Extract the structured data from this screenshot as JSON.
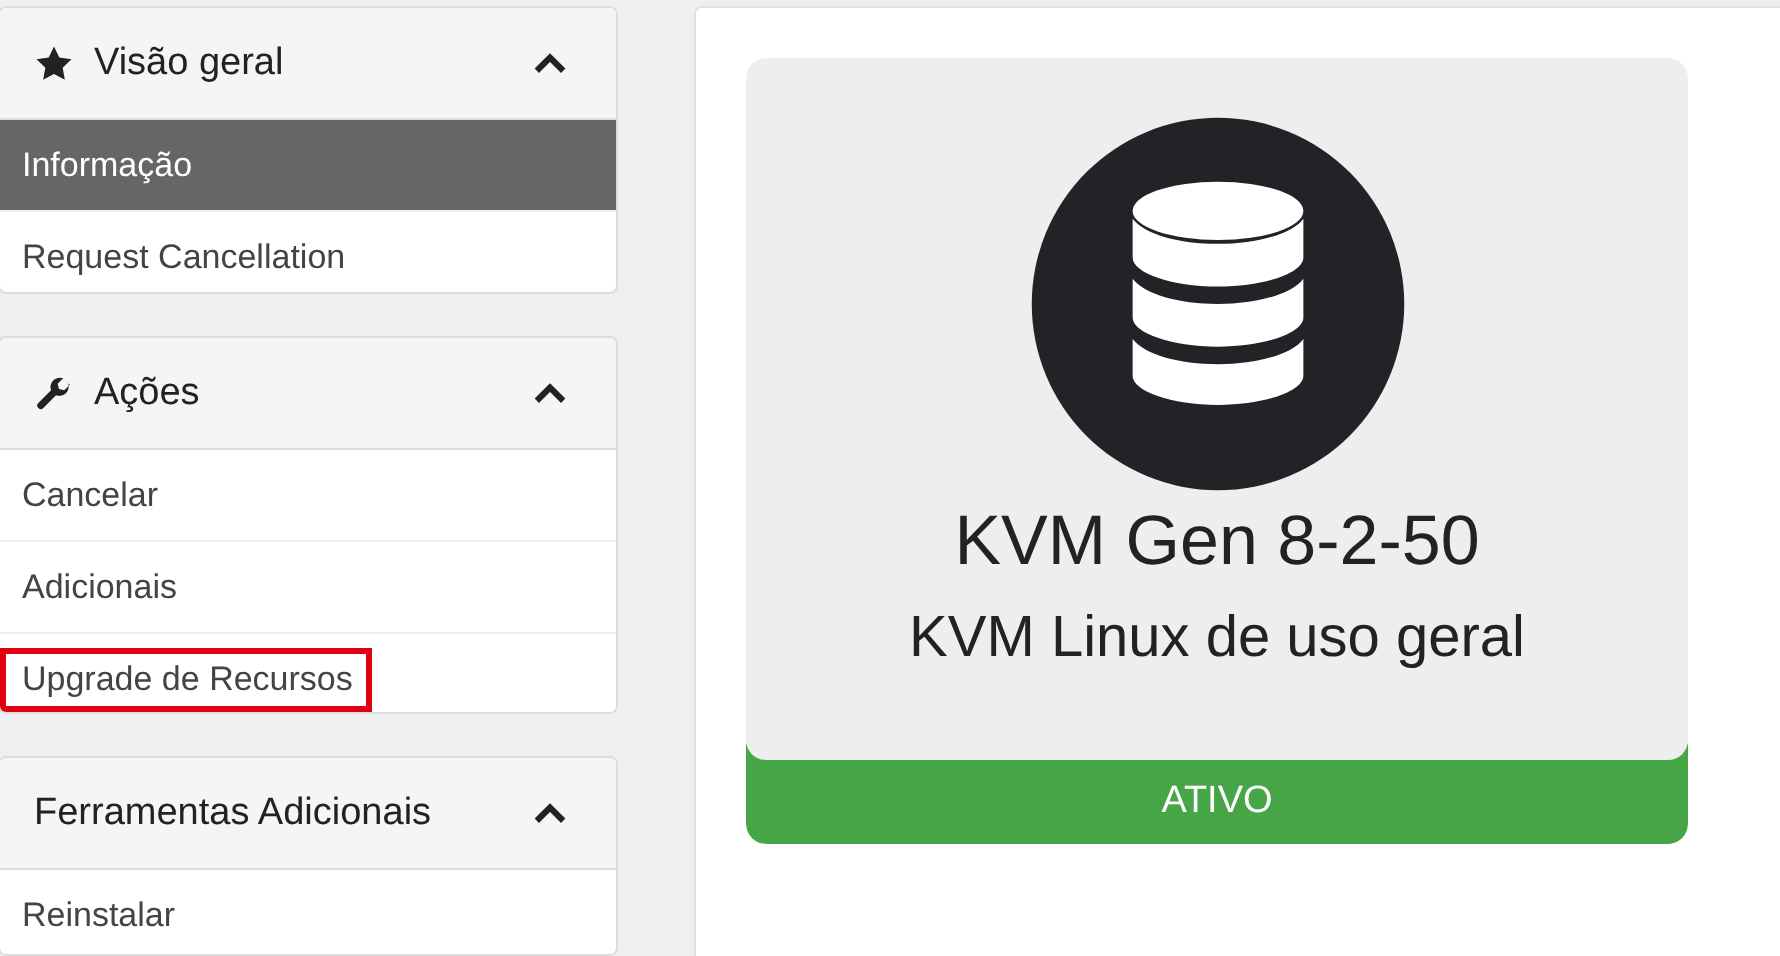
{
  "sidebar": {
    "panels": [
      {
        "title": "Visão geral",
        "expanded": true,
        "items": [
          {
            "label": "Informação",
            "selected": true,
            "highlighted": false
          },
          {
            "label": "Request Cancellation",
            "selected": false,
            "highlighted": false
          }
        ]
      },
      {
        "title": "Ações",
        "expanded": true,
        "items": [
          {
            "label": "Cancelar",
            "selected": false,
            "highlighted": false
          },
          {
            "label": "Adicionais",
            "selected": false,
            "highlighted": false
          },
          {
            "label": "Upgrade de Recursos",
            "selected": false,
            "highlighted": true
          }
        ]
      },
      {
        "title": "Ferramentas Adicionais",
        "expanded": true,
        "items": [
          {
            "label": "Reinstalar",
            "selected": false,
            "highlighted": false
          }
        ]
      }
    ]
  },
  "product": {
    "name": "KVM Gen 8-2-50",
    "group": "KVM Linux de uso geral",
    "status": "ATIVO"
  }
}
